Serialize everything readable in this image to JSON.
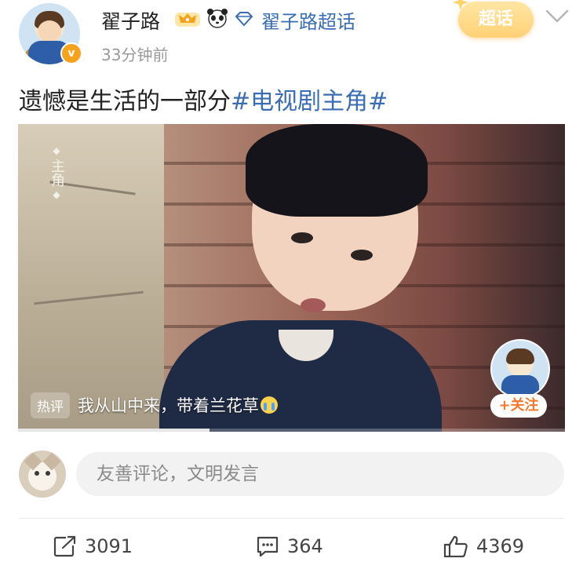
{
  "post": {
    "author": {
      "name": "翟子路",
      "super_topic": "翟子路超话",
      "badges": [
        "crown-icon",
        "panda-icon",
        "diamond-icon"
      ],
      "verified": true
    },
    "timestamp": "33分钟前",
    "topic_tag": "超话",
    "text": "遗憾是生活的一部分",
    "hashtag": "#电视剧主角#",
    "video": {
      "vertical_title": "主角",
      "hot_comment_label": "热评",
      "hot_comment": "我从山中来，带着兰花草",
      "follow_label": "+关注",
      "progress": 0.35
    }
  },
  "comment_box": {
    "placeholder": "友善评论，文明发言"
  },
  "actions": {
    "repost_count": "3091",
    "comment_count": "364",
    "like_count": "4369"
  },
  "colors": {
    "link": "#3a6db3",
    "follow": "#f4782b",
    "topic_tag": "#ffd176"
  }
}
